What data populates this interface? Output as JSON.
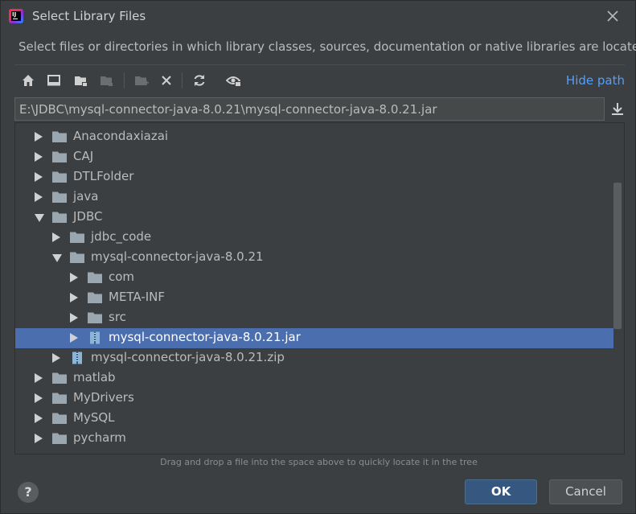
{
  "window": {
    "title": "Select Library Files",
    "description": "Select files or directories in which library classes, sources, documentation or native libraries are located"
  },
  "toolbar": {
    "buttons": [
      "home-icon",
      "desktop-icon",
      "project-folder-icon",
      "module-folder-icon",
      "new-folder-icon",
      "delete-icon",
      "refresh-icon",
      "show-hidden-icon"
    ],
    "hide_path_label": "Hide path"
  },
  "path": {
    "value": "E:\\JDBC\\mysql-connector-java-8.0.21\\mysql-connector-java-8.0.21.jar"
  },
  "tree": {
    "items": [
      {
        "label": "Anacondaxiazai",
        "level": 0,
        "expanded": false,
        "type": "folder"
      },
      {
        "label": "CAJ",
        "level": 0,
        "expanded": false,
        "type": "folder"
      },
      {
        "label": "DTLFolder",
        "level": 0,
        "expanded": false,
        "type": "folder"
      },
      {
        "label": "java",
        "level": 0,
        "expanded": false,
        "type": "folder"
      },
      {
        "label": "JDBC",
        "level": 0,
        "expanded": true,
        "type": "folder"
      },
      {
        "label": "jdbc_code",
        "level": 1,
        "expanded": false,
        "type": "folder"
      },
      {
        "label": "mysql-connector-java-8.0.21",
        "level": 1,
        "expanded": true,
        "type": "folder"
      },
      {
        "label": "com",
        "level": 2,
        "expanded": false,
        "type": "folder"
      },
      {
        "label": "META-INF",
        "level": 2,
        "expanded": false,
        "type": "folder"
      },
      {
        "label": "src",
        "level": 2,
        "expanded": false,
        "type": "folder"
      },
      {
        "label": "mysql-connector-java-8.0.21.jar",
        "level": 2,
        "expanded": false,
        "type": "archive",
        "selected": true
      },
      {
        "label": "mysql-connector-java-8.0.21.zip",
        "level": 1,
        "expanded": false,
        "type": "archive"
      },
      {
        "label": "matlab",
        "level": 0,
        "expanded": false,
        "type": "folder"
      },
      {
        "label": "MyDrivers",
        "level": 0,
        "expanded": false,
        "type": "folder"
      },
      {
        "label": "MySQL",
        "level": 0,
        "expanded": false,
        "type": "folder"
      },
      {
        "label": "pycharm",
        "level": 0,
        "expanded": false,
        "type": "folder"
      }
    ]
  },
  "hint": "Drag and drop a file into the space above to quickly locate it in the tree",
  "buttons": {
    "help": "?",
    "ok": "OK",
    "cancel": "Cancel"
  },
  "colors": {
    "background": "#3c3f41",
    "selection": "#4b6eaf",
    "link": "#589df6",
    "ok_button": "#365880"
  }
}
